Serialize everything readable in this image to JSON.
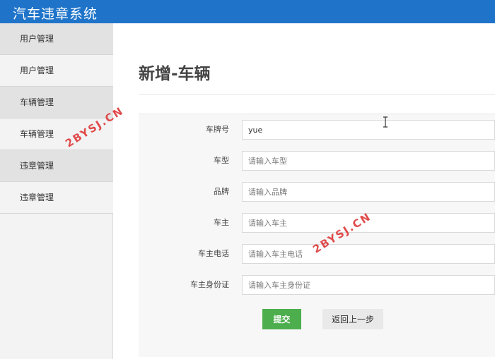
{
  "header": {
    "title": "汽车违章系统"
  },
  "sidebar": {
    "items": [
      {
        "label": "用户管理",
        "type": "group"
      },
      {
        "label": "用户管理",
        "type": "sub"
      },
      {
        "label": "车辆管理",
        "type": "group"
      },
      {
        "label": "车辆管理",
        "type": "sub"
      },
      {
        "label": "违章管理",
        "type": "group"
      },
      {
        "label": "违章管理",
        "type": "sub"
      }
    ]
  },
  "main": {
    "page_title": "新增-车辆",
    "form": {
      "fields": [
        {
          "label": "车牌号",
          "value": "yue",
          "placeholder": ""
        },
        {
          "label": "车型",
          "value": "",
          "placeholder": "请输入车型"
        },
        {
          "label": "品牌",
          "value": "",
          "placeholder": "请输入品牌"
        },
        {
          "label": "车主",
          "value": "",
          "placeholder": "请输入车主"
        },
        {
          "label": "车主电话",
          "value": "",
          "placeholder": "请输入车主电话"
        },
        {
          "label": "车主身份证",
          "value": "",
          "placeholder": "请输入车主身份证"
        }
      ],
      "submit_label": "提交",
      "back_label": "返回上一步"
    }
  },
  "watermark": {
    "text": "2BYSJ.CN"
  },
  "colors": {
    "header_bg": "#1f74c9",
    "submit_bg": "#4cae4c",
    "watermark": "#e04a4a"
  }
}
